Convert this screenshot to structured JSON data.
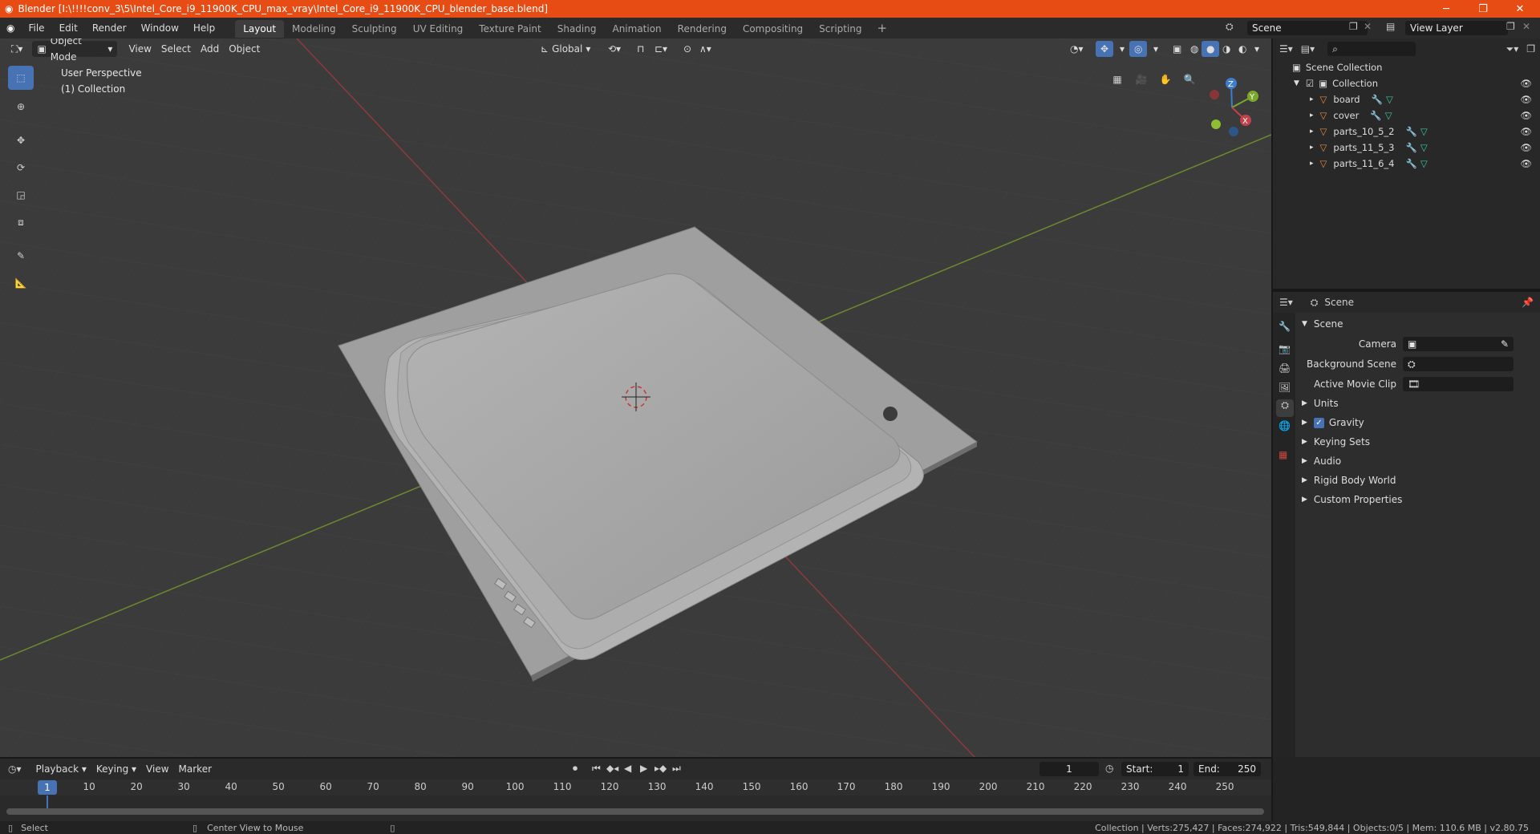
{
  "window": {
    "title": "Blender [I:\\!!!!conv_3\\5\\Intel_Core_i9_11900K_CPU_max_vray\\Intel_Core_i9_11900K_CPU_blender_base.blend]"
  },
  "menus": [
    "File",
    "Edit",
    "Render",
    "Window",
    "Help"
  ],
  "workspaces": [
    "Layout",
    "Modeling",
    "Sculpting",
    "UV Editing",
    "Texture Paint",
    "Shading",
    "Animation",
    "Rendering",
    "Compositing",
    "Scripting"
  ],
  "active_workspace": "Layout",
  "scene_field": "Scene",
  "view_layer_field": "View Layer",
  "viewport": {
    "mode": "Object Mode",
    "menus": [
      "View",
      "Select",
      "Add",
      "Object"
    ],
    "orientation": "Global",
    "overlay_line1": "User Perspective",
    "overlay_line2": "(1) Collection",
    "gizmo_labels": {
      "x": "X",
      "y": "Y",
      "z": "Z"
    }
  },
  "outliner": {
    "root": "Scene Collection",
    "collection": "Collection",
    "items": [
      "board",
      "cover",
      "parts_10_5_2",
      "parts_11_5_3",
      "parts_11_6_4"
    ]
  },
  "properties": {
    "context": "Scene",
    "panel": "Scene",
    "fields": [
      {
        "label": "Camera",
        "value": ""
      },
      {
        "label": "Background Scene",
        "value": ""
      },
      {
        "label": "Active Movie Clip",
        "value": ""
      }
    ],
    "sections": [
      "Units",
      "Gravity",
      "Keying Sets",
      "Audio",
      "Rigid Body World",
      "Custom Properties"
    ],
    "gravity_checked": true
  },
  "timeline": {
    "menus": [
      "Playback",
      "Keying",
      "View",
      "Marker"
    ],
    "current_frame": "1",
    "start_label": "Start:",
    "start": "1",
    "end_label": "End:",
    "end": "250",
    "ticks": [
      "1",
      "10",
      "20",
      "30",
      "40",
      "50",
      "60",
      "70",
      "80",
      "90",
      "100",
      "110",
      "120",
      "130",
      "140",
      "150",
      "160",
      "170",
      "180",
      "190",
      "200",
      "210",
      "220",
      "230",
      "240",
      "250"
    ]
  },
  "statusbar": {
    "left": "Select",
    "middle": "Center View to Mouse",
    "right": "Collection | Verts:275,427 | Faces:274,922 | Tris:549,844 | Objects:0/5 | Mem: 110.6 MB | v2.80.75"
  },
  "colors": {
    "titlebar": "#e74c15",
    "accent": "#4772b3",
    "x_axis": "#c2414b",
    "y_axis": "#7aa82b",
    "z_axis": "#3d7dcc",
    "mesh_icon": "#e8893a",
    "modifier_icon": "#6fa8e8",
    "data_icon": "#38c9a3"
  }
}
